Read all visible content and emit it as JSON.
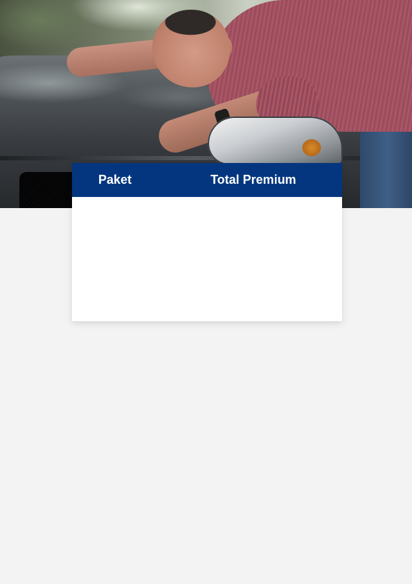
{
  "hero": {
    "image": "man-hugging-car-hood-photo"
  },
  "table": {
    "headers": {
      "paket": "Paket",
      "total_premium": "Total Premium"
    },
    "header_color": "#03367f",
    "rows": []
  },
  "colors": {
    "background": "#f3f3f3",
    "card": "#ffffff",
    "header_text": "#ffffff"
  }
}
